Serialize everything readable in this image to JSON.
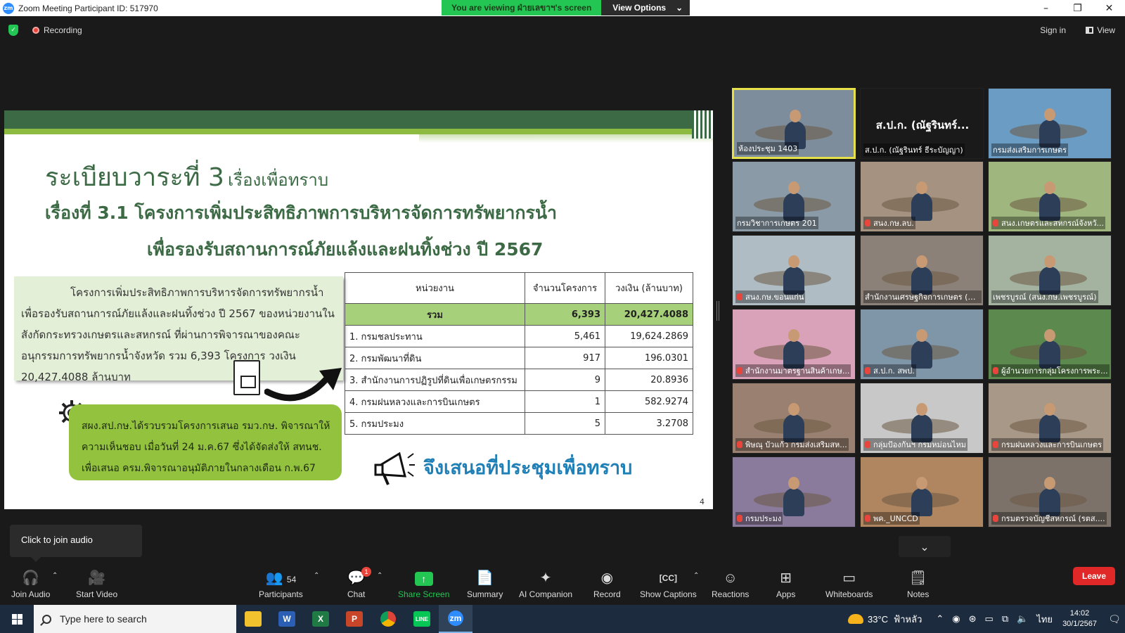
{
  "window": {
    "title": "Zoom Meeting Participant ID: 517970",
    "logo": "zm",
    "viewing_banner": "You are viewing ฝ่ายเลขาฯ's screen",
    "view_options": "View Options"
  },
  "topbar": {
    "recording": "Recording",
    "sign_in": "Sign in",
    "view": "View"
  },
  "slide": {
    "title": "ระเบียบวาระที่ 3",
    "title_suffix": "เรื่องเพื่อทราบ",
    "subtitle_line1": "เรื่องที่  3.1  โครงการเพิ่มประสิทธิภาพการบริหารจัดการทรัพยากรน้ำ",
    "subtitle_line2": "เพื่อรองรับสถานการณ์ภัยแล้งและฝนทิ้งช่วง ปี 2567",
    "info_text": "โครงการเพิ่มประสิทธิภาพการบริหารจัดการทรัพยากรน้ำเพื่อรองรับสถานการณ์ภัยแล้งและฝนทิ้งช่วง ปี 2567 ของหน่วยงานในสังกัดกระทรวงเกษตรและสหกรณ์ ที่ผ่านการพิจารณาของคณะอนุกรรมการทรัพยากรน้ำจังหวัด รวม 6,393 โครงการ วงเงิน 20,427.4088 ล้านบาท",
    "note_text": "สผง.สป.กษ.ได้รวบรวมโครงการเสนอ รมว.กษ. พิจารณาให้ความเห็นชอบ เมื่อวันที่ 24 ม.ค.67 ซึ่งได้จัดส่งให้ สทนช. เพื่อเสนอ ครม.พิจารณาอนุมัติภายในกลางเดือน ก.พ.67",
    "table": {
      "headers": [
        "หน่วยงาน",
        "จำนวนโครงการ",
        "วงเงิน (ล้านบาท)"
      ],
      "total": {
        "label": "รวม",
        "count": "6,393",
        "amount": "20,427.4088"
      },
      "rows": [
        {
          "label": "1. กรมชลประทาน",
          "count": "5,461",
          "amount": "19,624.2869"
        },
        {
          "label": "2. กรมพัฒนาที่ดิน",
          "count": "917",
          "amount": "196.0301"
        },
        {
          "label": "3. สำนักงานการปฏิรูปที่ดินเพื่อเกษตรกรรม",
          "count": "9",
          "amount": "20.8936"
        },
        {
          "label": "4. กรมฝนหลวงและการบินเกษตร",
          "count": "1",
          "amount": "582.9274"
        },
        {
          "label": "5. กรมประมง",
          "count": "5",
          "amount": "3.2708"
        }
      ]
    },
    "announcement": "จึงเสนอที่ประชุมเพื่อทราบ",
    "page_number": "4"
  },
  "gallery": {
    "tiles": [
      {
        "label": "ห้องประชุม 1403",
        "muted": false,
        "bg": "#7d8d9c",
        "name_only": false
      },
      {
        "label": "ส.ป.ก. (ณัฐรินทร์ ธีระบัญญา)",
        "muted": false,
        "bg": "#1a1a1a",
        "name_only": true,
        "display_name": "ส.ป.ก. (ณัฐรินทร์..."
      },
      {
        "label": "กรมส่งเสริมการเกษตร",
        "muted": false,
        "bg": "#6a9cc4",
        "name_only": false
      },
      {
        "label": "กรมวิชาการเกษตร 201",
        "muted": false,
        "bg": "#8a9aa6",
        "name_only": false
      },
      {
        "label": "สนง.กษ.ลบ.",
        "muted": true,
        "bg": "#a69280",
        "name_only": false
      },
      {
        "label": "สนง.เกษตรและสหกรณ์จังหวั...",
        "muted": true,
        "bg": "#9fb77e",
        "name_only": false
      },
      {
        "label": "สนง.กษ.ขอนแก่น",
        "muted": true,
        "bg": "#b0bcc4",
        "name_only": false
      },
      {
        "label": "สำนักงานเศรษฐกิจการเกษตร (ห้...",
        "muted": false,
        "bg": "#8c8178",
        "name_only": false
      },
      {
        "label": "เพชรบูรณ์ (สนง.กษ.เพชรบูรณ์)",
        "muted": false,
        "bg": "#a4b2a0",
        "name_only": false
      },
      {
        "label": "สำนักงานมาตรฐานสินค้าเกษ...",
        "muted": true,
        "bg": "#d9a2b8",
        "name_only": false
      },
      {
        "label": "ส.ป.ก. สพป.",
        "muted": true,
        "bg": "#7f96a8",
        "name_only": false
      },
      {
        "label": "ผู้อำนวยการกลุ่มโครงการพระ...",
        "muted": true,
        "bg": "#5c8a4e",
        "name_only": false
      },
      {
        "label": "พิษณุ บัวแก้ว กรมส่งเสริมสห...",
        "muted": true,
        "bg": "#9a8070",
        "name_only": false
      },
      {
        "label": "กลุ่มป้องกันฯ กรมหม่อนไหม",
        "muted": true,
        "bg": "#c8c8c8",
        "name_only": false
      },
      {
        "label": "กรมฝนหลวงและการบินเกษตร",
        "muted": true,
        "bg": "#a89888",
        "name_only": false
      },
      {
        "label": "กรมประมง",
        "muted": true,
        "bg": "#8a7a9c",
        "name_only": false
      },
      {
        "label": "พค._UNCCD",
        "muted": true,
        "bg": "#b08660",
        "name_only": false
      },
      {
        "label": "กรมตรวจบัญชีสหกรณ์ (รตส....",
        "muted": true,
        "bg": "#7c726a",
        "name_only": false
      }
    ]
  },
  "tooltip": {
    "text": "Click to join audio"
  },
  "toolbar": {
    "join_audio": "Join Audio",
    "start_video": "Start Video",
    "participants": "Participants",
    "participants_count": "54",
    "chat": "Chat",
    "chat_badge": "1",
    "share_screen": "Share Screen",
    "summary": "Summary",
    "ai_companion": "AI Companion",
    "record": "Record",
    "show_captions": "Show Captions",
    "reactions": "Reactions",
    "apps": "Apps",
    "whiteboards": "Whiteboards",
    "notes": "Notes",
    "leave": "Leave"
  },
  "taskbar": {
    "search_placeholder": "Type here to search",
    "temperature": "33°C",
    "weather": "ฟ้าหลัว",
    "language": "ไทย",
    "time": "14:02",
    "date": "30/1/2567"
  }
}
